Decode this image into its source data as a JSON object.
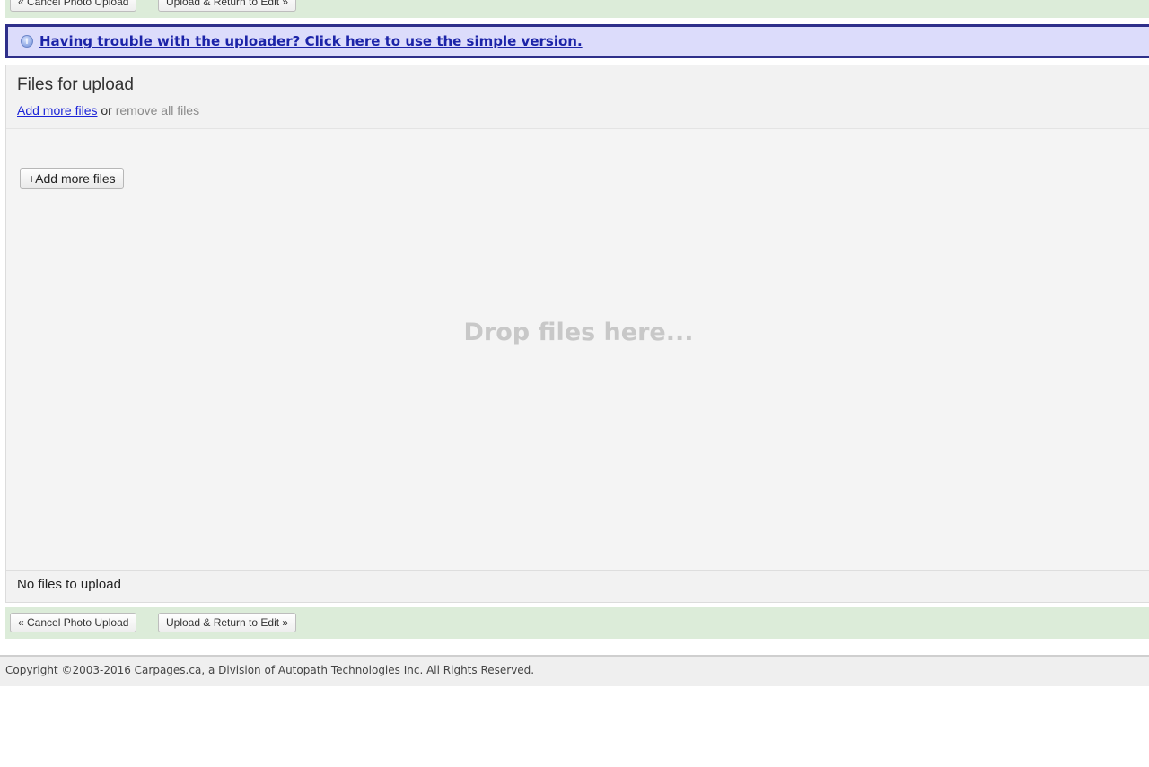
{
  "top_actions": {
    "cancel_label": "« Cancel Photo Upload",
    "upload_label": "Upload & Return to Edit »"
  },
  "notice": {
    "icon": "info-icon",
    "text": "Having trouble with the uploader? Click here to use the simple version."
  },
  "uploader": {
    "title": "Files for upload",
    "add_more_link": "Add more files",
    "or_text": "or",
    "remove_all_text": "remove all files",
    "add_more_button": "+Add more files",
    "drop_text": "Drop files here...",
    "status_text": "No files to upload"
  },
  "bottom_actions": {
    "cancel_label": "« Cancel Photo Upload",
    "upload_label": "Upload & Return to Edit »"
  },
  "footer": {
    "copyright": "Copyright ©2003-2016 Carpages.ca, a Division of Autopath Technologies Inc. All Rights Reserved."
  },
  "colors": {
    "action_bar_bg": "#dcecd9",
    "notice_bg": "#dcdcfb",
    "notice_border": "#2e2f8a",
    "link": "#1c24d8"
  }
}
